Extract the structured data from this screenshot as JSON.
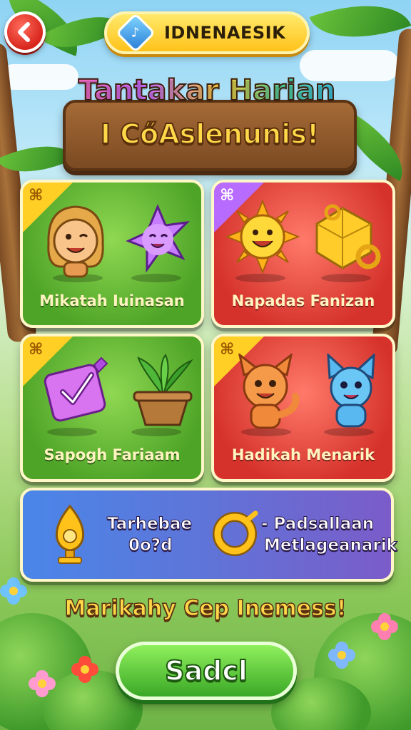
{
  "header": {
    "back_icon": "back-arrow-icon",
    "title": "IDNENAESIK",
    "title_icon": "music-note-gem-icon"
  },
  "heading": {
    "line1": "Tantakar Harian",
    "line2": "I CőAslenunis!"
  },
  "cards": [
    {
      "label": "Mikatah Iuinasan",
      "color": "green",
      "badge_icon": "gift-icon",
      "items": [
        "girl-character-icon",
        "purple-star-character-icon"
      ]
    },
    {
      "label": "Napadas Fanizan",
      "color": "red",
      "badge_icon": "gift-icon",
      "items": [
        "sun-character-icon",
        "gold-gem-key-icon"
      ]
    },
    {
      "label": "Sapogh Fariaam",
      "color": "green",
      "badge_icon": "gift-icon",
      "items": [
        "purple-checklist-icon",
        "potted-plant-icon"
      ]
    },
    {
      "label": "Hadikah Menarik",
      "color": "red",
      "badge_icon": "gift-icon",
      "items": [
        "orange-fox-character-icon",
        "blue-cat-character-icon"
      ]
    }
  ],
  "reward": {
    "left_line1": "Tarhebae",
    "left_line2": "0o?d",
    "right_line1": "- Padsallaan",
    "right_line2": "Metlageanarik",
    "left_icon": "golden-trophy-icon",
    "right_icon": "gold-ring-icon"
  },
  "subtitle": "Marikahy Cep Inemess!",
  "start_button": "Sadcl",
  "colors": {
    "green_card": "#4ea427",
    "red_card": "#d5322b",
    "reward_bar": "#5f74d8",
    "accent_yellow": "#ffd84a"
  }
}
